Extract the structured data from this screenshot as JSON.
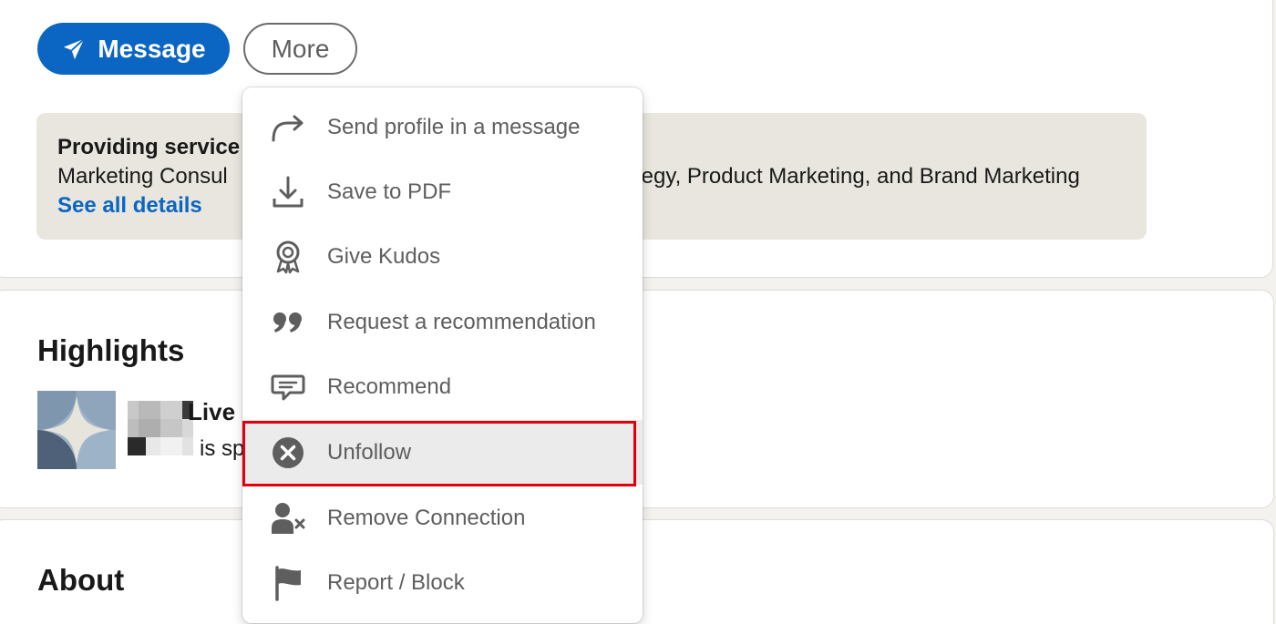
{
  "actions": {
    "message_label": "Message",
    "more_label": "More"
  },
  "services": {
    "title": "Providing service",
    "description": "Marketing Consul",
    "description_tail": "tegy, Product Marketing, and Brand Marketing",
    "link": "See all details"
  },
  "highlights": {
    "heading": "Highlights",
    "item_title": "Live",
    "item_text": "is sp"
  },
  "about": {
    "heading": "About"
  },
  "menu": {
    "items": [
      {
        "label": "Send profile in a message",
        "icon": "share-arrow-icon"
      },
      {
        "label": "Save to PDF",
        "icon": "download-icon"
      },
      {
        "label": "Give Kudos",
        "icon": "award-ribbon-icon"
      },
      {
        "label": "Request a recommendation",
        "icon": "quote-icon"
      },
      {
        "label": "Recommend",
        "icon": "speech-bubble-icon"
      },
      {
        "label": "Unfollow",
        "icon": "close-circle-icon"
      },
      {
        "label": "Remove Connection",
        "icon": "person-remove-icon"
      },
      {
        "label": "Report / Block",
        "icon": "flag-icon"
      }
    ],
    "active_index": 5
  },
  "colors": {
    "brand": "#0a66c2",
    "menu_text": "#5e5e5e",
    "highlight_border": "#e0000e",
    "active_row": "#ebebeb"
  }
}
